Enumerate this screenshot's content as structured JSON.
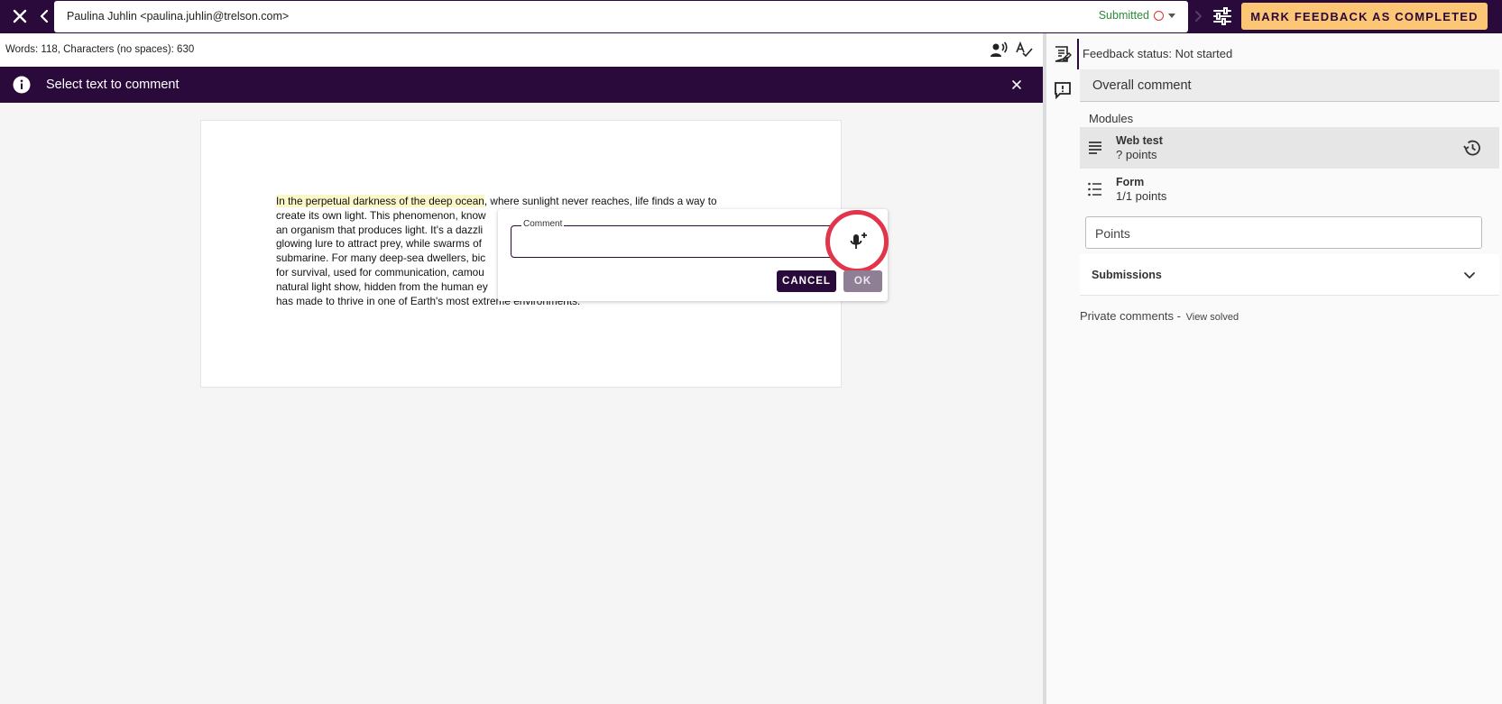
{
  "topbar": {
    "student": "Paulina Juhlin <paulina.juhlin@trelson.com>",
    "status": "Submitted",
    "mark_button": "MARK FEEDBACK AS COMPLETED"
  },
  "editor": {
    "word_count": "Words: 118, Characters (no spaces): 630",
    "banner_text": "Select text to comment",
    "essay_highlight": "In the perpetual darkness of the deep ocean",
    "essay_lines": [
      ", where sunlight never reaches, life finds a way to",
      "create its own light. This phenomenon, know",
      "an organism that produces light. It's a dazzli",
      "glowing lure to attract prey, while swarms of",
      "submarine. For many deep-sea dwellers, bic",
      "for survival, used for communication, camou",
      "natural light show, hidden from the human ey",
      "has made to thrive in one of Earth's most extreme environments."
    ]
  },
  "comment_popup": {
    "label": "Comment",
    "value": "",
    "cancel": "CANCEL",
    "ok": "OK"
  },
  "sidebar": {
    "feedback_status": "Feedback status: Not started",
    "overall_comment": "Overall comment",
    "modules_label": "Modules",
    "modules": [
      {
        "name": "Web test",
        "points": "? points"
      },
      {
        "name": "Form",
        "points": "1/1 points"
      }
    ],
    "points_placeholder": "Points",
    "submissions": "Submissions",
    "private_comments": "Private comments -",
    "view_solved": "View solved"
  }
}
